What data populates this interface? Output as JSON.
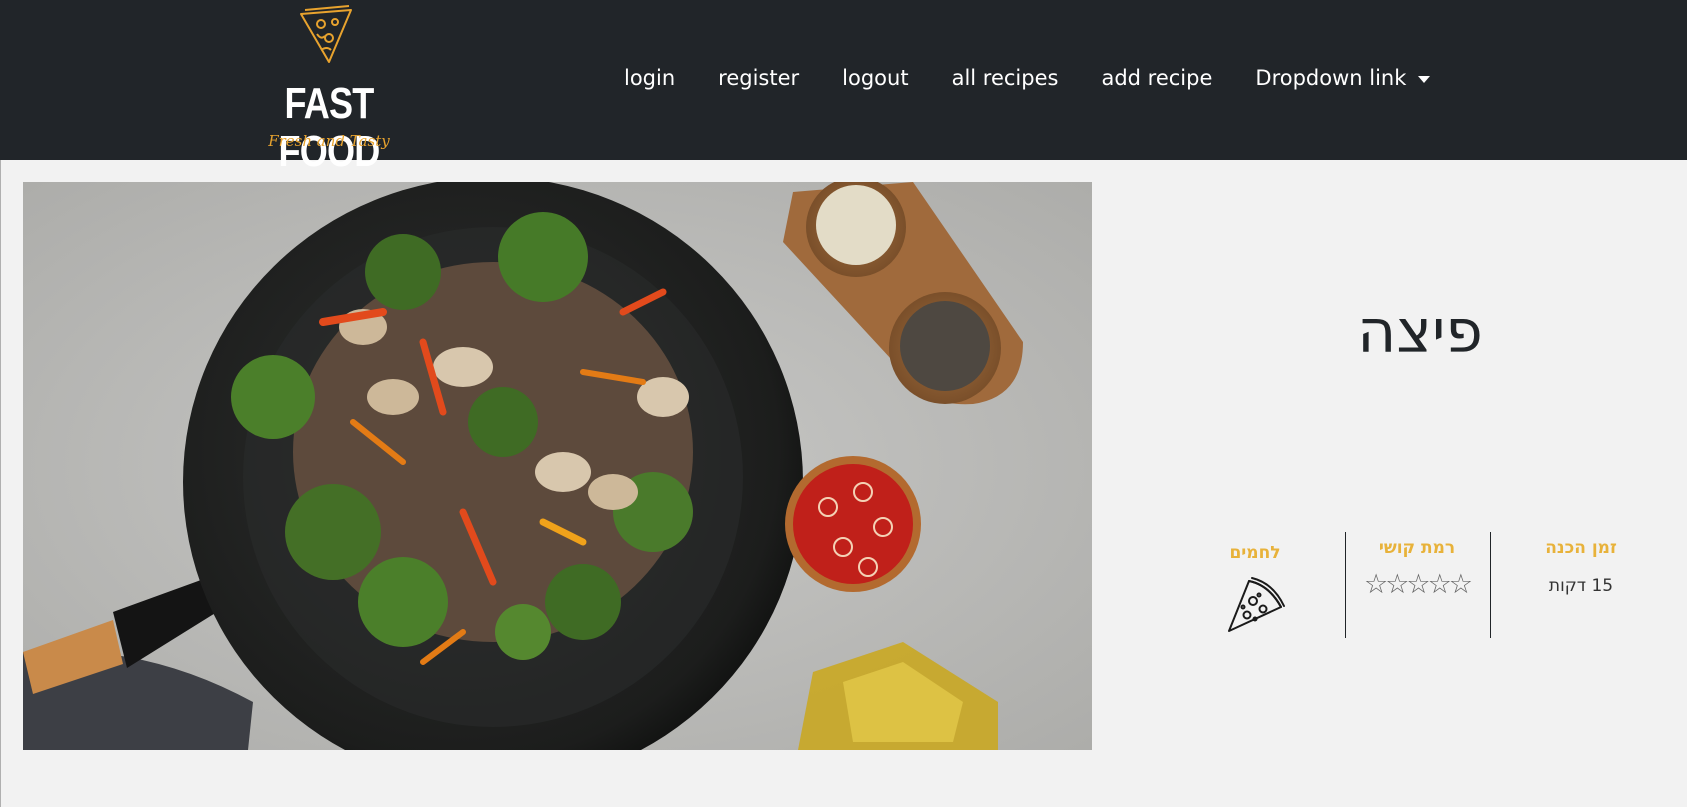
{
  "nav": {
    "logo_title": "FAST FOOD",
    "logo_tagline": "Fresh and Tasty",
    "links": [
      "login",
      "register",
      "logout",
      "all recipes",
      "add recipe"
    ],
    "dropdown_label": "Dropdown link"
  },
  "recipe": {
    "title": "פיצה",
    "prep_time_label": "זמן הכנה",
    "prep_time_value": "15 דקות",
    "difficulty_label": "רמת קושי",
    "difficulty_stars": "☆☆☆☆☆",
    "difficulty_rating": 0,
    "category_label": "לחמים",
    "category_icon": "pizza-slice-icon"
  },
  "colors": {
    "navbar_bg": "#212529",
    "page_bg": "#f2f2f2",
    "accent_gold": "#e8b23a",
    "logo_orange": "#e8a32e"
  }
}
